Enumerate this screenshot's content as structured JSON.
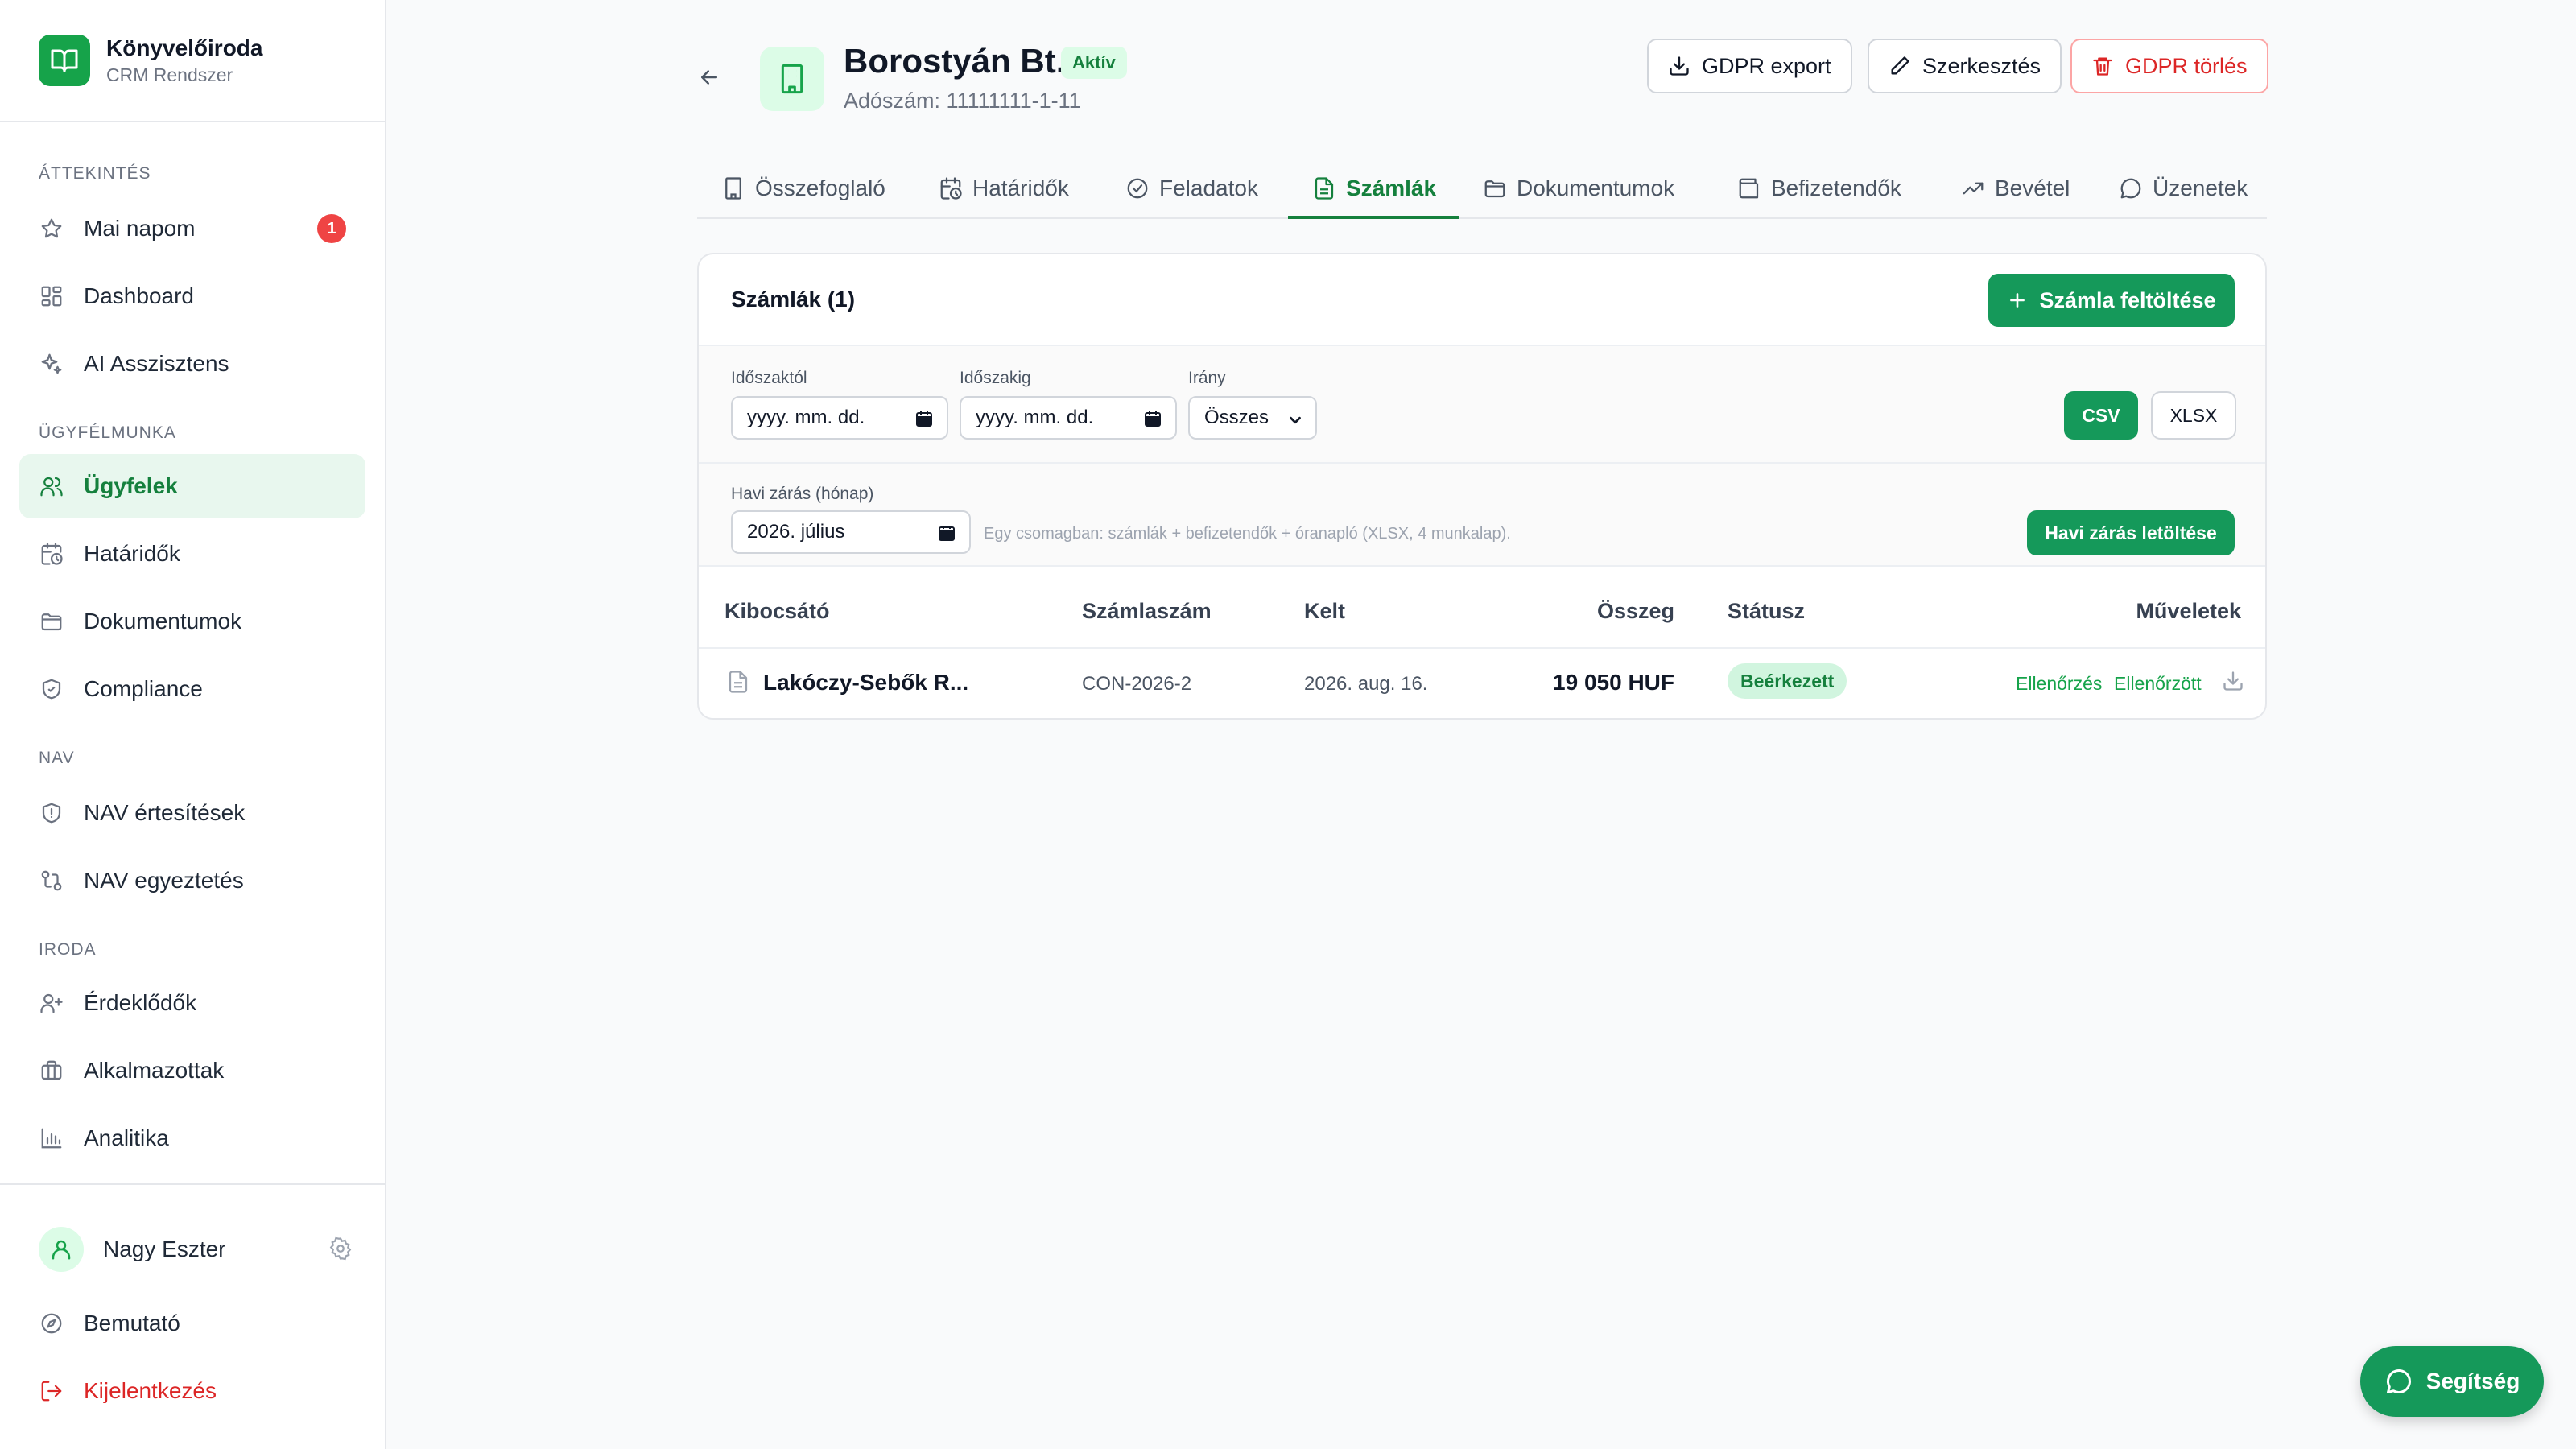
{
  "app": {
    "name": "Könyvelőiroda",
    "subtitle": "CRM Rendszer"
  },
  "sidebar": {
    "sections": [
      {
        "label": "ÁTTEKINTÉS"
      },
      {
        "label": "ÜGYFÉLMUNKA"
      },
      {
        "label": "NAV"
      },
      {
        "label": "IRODA"
      }
    ],
    "items": [
      {
        "label": "Mai napom",
        "icon": "star-icon",
        "badge": "1"
      },
      {
        "label": "Dashboard",
        "icon": "grid-icon"
      },
      {
        "label": "AI Asszisztens",
        "icon": "sparkles-icon"
      },
      {
        "label": "Ügyfelek",
        "icon": "users-icon",
        "active": true
      },
      {
        "label": "Határidők",
        "icon": "calendar-clock-icon"
      },
      {
        "label": "Dokumentumok",
        "icon": "folder-icon"
      },
      {
        "label": "Compliance",
        "icon": "shield-check-icon"
      },
      {
        "label": "NAV értesítések",
        "icon": "shield-alert-icon"
      },
      {
        "label": "NAV egyeztetés",
        "icon": "git-compare-icon"
      },
      {
        "label": "Érdeklődők",
        "icon": "user-plus-icon"
      },
      {
        "label": "Alkalmazottak",
        "icon": "briefcase-icon"
      },
      {
        "label": "Analitika",
        "icon": "bar-chart-icon"
      }
    ],
    "user": {
      "name": "Nagy Eszter"
    },
    "footer": [
      {
        "label": "Bemutató",
        "icon": "compass-icon"
      },
      {
        "label": "Kijelentkezés",
        "icon": "logout-icon"
      }
    ]
  },
  "client": {
    "name": "Borostyán Bt.",
    "status": "Aktív",
    "tax_id": "Adószám: 11111111-1-11"
  },
  "header_actions": {
    "gdpr_export": "GDPR export",
    "edit": "Szerkesztés",
    "gdpr_delete": "GDPR törlés"
  },
  "tabs": [
    {
      "label": "Összefoglaló",
      "icon": "building-icon"
    },
    {
      "label": "Határidők",
      "icon": "calendar-clock-icon"
    },
    {
      "label": "Feladatok",
      "icon": "check-circle-icon"
    },
    {
      "label": "Számlák",
      "icon": "file-text-icon",
      "active": true
    },
    {
      "label": "Dokumentumok",
      "icon": "folder-icon"
    },
    {
      "label": "Befizetendők",
      "icon": "wallet-icon"
    },
    {
      "label": "Bevétel",
      "icon": "trending-up-icon"
    },
    {
      "label": "Üzenetek",
      "icon": "message-icon"
    }
  ],
  "invoices": {
    "title": "Számlák (1)",
    "upload_label": "Számla feltöltése",
    "filters": {
      "from_label": "Időszaktól",
      "from_value": "yyyy. mm. dd.",
      "to_label": "Időszakig",
      "to_value": "yyyy. mm. dd.",
      "direction_label": "Irány",
      "direction_value": "Összes",
      "csv_label": "CSV",
      "xlsx_label": "XLSX",
      "monthly_label": "Havi zárás (hónap)",
      "monthly_value": "2026. július",
      "monthly_hint": "Egy csomagban: számlák + befizetendők + óranapló (XLSX, 4 munkalap).",
      "monthly_download": "Havi zárás letöltése"
    },
    "columns": {
      "issuer": "Kibocsátó",
      "number": "Számlaszám",
      "date": "Kelt",
      "amount": "Összeg",
      "status": "Státusz",
      "actions": "Műveletek"
    },
    "rows": [
      {
        "issuer": "Lakóczy-Sebők R...",
        "number": "CON-2026-2",
        "date": "2026. aug. 16.",
        "amount": "19 050 HUF",
        "status": "Beérkezett",
        "action_check": "Ellenőrzés",
        "action_verified": "Ellenőrzött"
      }
    ]
  },
  "help": {
    "label": "Segítség"
  },
  "colors": {
    "accent": "#15995a",
    "accent_text": "#15803d",
    "danger": "#dc2626"
  }
}
